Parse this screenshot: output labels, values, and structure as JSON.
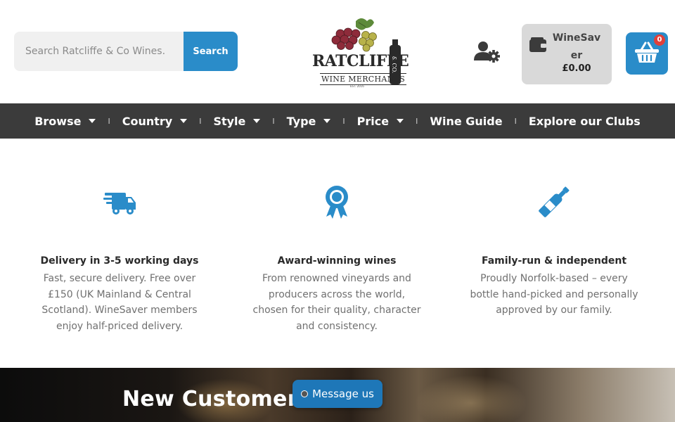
{
  "header": {
    "search": {
      "placeholder": "Search Ratcliffe & Co Wines.",
      "button_label": "Search"
    },
    "logo": {
      "name": "RATCLIFFE",
      "sub": "WINE MERCHANTS",
      "est": "EST. 2016",
      "badge": "& CO."
    },
    "account_icon": "user-gear-icon",
    "winesaver": {
      "title": "WineSaver",
      "amount": "£0.00",
      "icon": "wallet-icon"
    },
    "basket": {
      "count": "0",
      "icon": "basket-icon"
    }
  },
  "nav": {
    "items": [
      {
        "label": "Browse",
        "has_dropdown": true
      },
      {
        "label": "Country",
        "has_dropdown": true
      },
      {
        "label": "Style",
        "has_dropdown": true
      },
      {
        "label": "Type",
        "has_dropdown": true
      },
      {
        "label": "Price",
        "has_dropdown": true
      },
      {
        "label": "Wine Guide",
        "has_dropdown": false
      },
      {
        "label": "Explore our Clubs",
        "has_dropdown": false
      }
    ],
    "separator": "I"
  },
  "features": [
    {
      "icon": "delivery-truck-icon",
      "title": "Delivery in 3-5 working days",
      "text": "Fast, secure delivery. Free over £150 (UK Mainland & Central Scotland). WineSaver members enjoy half-priced delivery."
    },
    {
      "icon": "award-ribbon-icon",
      "title": "Award-winning wines",
      "text": "From renowned vineyards and producers across the world, chosen for their quality, character and consistency."
    },
    {
      "icon": "wine-bottle-icon",
      "title": "Family-run & independent",
      "text": "Proudly Norfolk-based – every bottle hand-picked and personally approved by our family."
    }
  ],
  "banner": {
    "title": "New Customer"
  },
  "chat": {
    "label": "Message us"
  },
  "colors": {
    "accent": "#2a8cc9",
    "nav_bg": "#3b3b3b",
    "badge": "#e0403a",
    "winesaver_bg": "#d9d9d9"
  }
}
